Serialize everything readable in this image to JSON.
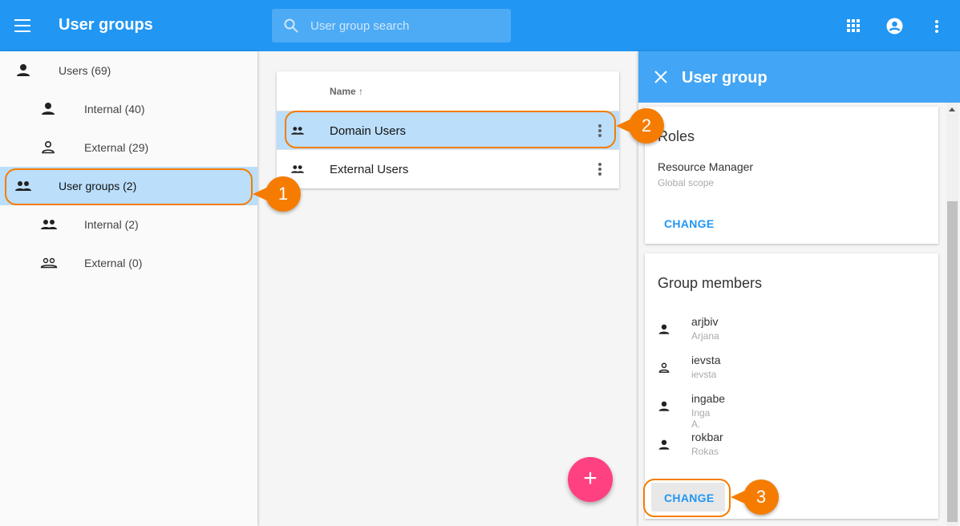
{
  "header": {
    "title": "User groups",
    "search_placeholder": "User group search"
  },
  "sidebar": {
    "items": [
      {
        "label": "Users (69)",
        "icon": "person-icon"
      },
      {
        "label": "Internal (40)",
        "icon": "person-icon"
      },
      {
        "label": "External (29)",
        "icon": "person-outline-icon"
      },
      {
        "label": "User groups (2)",
        "icon": "group-icon"
      },
      {
        "label": "Internal (2)",
        "icon": "group-icon"
      },
      {
        "label": "External (0)",
        "icon": "group-outline-icon"
      }
    ]
  },
  "table": {
    "column": "Name",
    "rows": [
      {
        "name": "Domain Users"
      },
      {
        "name": "External Users"
      }
    ]
  },
  "fab": "+",
  "panel": {
    "title": "User group",
    "roles": {
      "heading": "Roles",
      "role": "Resource Manager",
      "scope": "Global scope",
      "change": "CHANGE"
    },
    "members": {
      "heading": "Group members",
      "change": "CHANGE",
      "list": [
        {
          "user": "arjbiv",
          "name": "Arjana"
        },
        {
          "user": "ievsta",
          "name": "ievsta"
        },
        {
          "user": "ingabe",
          "name": "Inga A."
        },
        {
          "user": "rokbar",
          "name": "Rokas"
        }
      ]
    }
  },
  "callouts": [
    "1",
    "2",
    "3"
  ],
  "colors": {
    "primary": "#2196f3",
    "accent": "#ff4081",
    "callout": "#f57c00",
    "selected": "#bbdefb"
  }
}
